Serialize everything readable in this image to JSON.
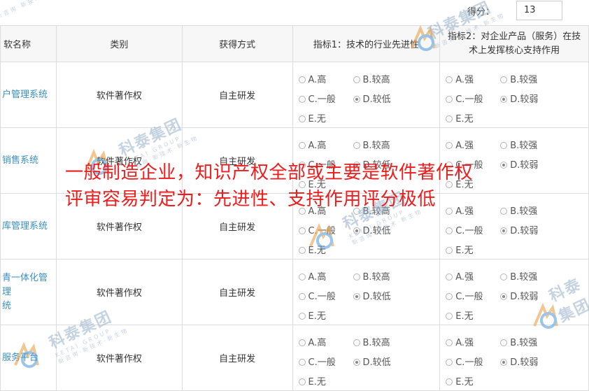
{
  "score": {
    "label": "得分：",
    "value": "13"
  },
  "headers": {
    "name": "软名称",
    "category": "类别",
    "method": "获得方式",
    "indicator1": "指标1：技术的行业先进性",
    "indicator2_line1": "指标2：对企业产品（服务）在技",
    "indicator2_line2": "术上发挥核心支持作用"
  },
  "rows": [
    {
      "name": "户管理系统",
      "category": "软件著作权",
      "method": "自主研发"
    },
    {
      "name": "销售系统",
      "category": "软件著作权",
      "method": "自主研发"
    },
    {
      "name": "库管理系统",
      "category": "软件著作权",
      "method": "自主研发"
    },
    {
      "name_line1": "青一体化管理",
      "name_line2": "统",
      "category": "软件著作权",
      "method": "自主研发"
    },
    {
      "name": "服务平台",
      "category": "软件著作权",
      "method": "自主研发"
    }
  ],
  "indicator1_options": [
    "A.高",
    "B.较高",
    "C.一般",
    "D.较低",
    "E.无"
  ],
  "indicator2_options": [
    "A.强",
    "B.较强",
    "C.一般",
    "D.较弱",
    "E.无"
  ],
  "selected": {
    "indicator1": "D.较低",
    "indicator2": "D.较弱"
  },
  "overlay": {
    "line1": "一般制造企业，知识产权全部或主要是软件著作权",
    "line2": "评审容易判定为：先进性、支持作用评分极低"
  },
  "watermark": {
    "brand": "科泰集团",
    "sub": "KETAI GROUP",
    "slogan": "新咨询·新技术·新生物"
  },
  "colors": {
    "overlay_text": "#ee1c1c",
    "link_text": "#3a8fc0",
    "header_bg": "#f7f7f7",
    "border": "#dcdcdc"
  }
}
